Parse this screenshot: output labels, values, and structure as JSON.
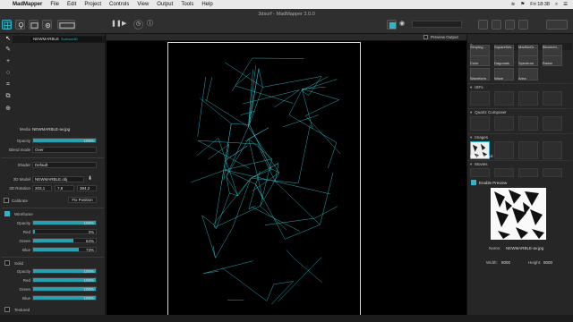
{
  "menubar": {
    "app_name": "MadMapper",
    "items": [
      "File",
      "Edit",
      "Project",
      "Controls",
      "View",
      "Output",
      "Tools",
      "Help"
    ],
    "clock": "Fri 18:38"
  },
  "window": {
    "title": "3dsurf - MadMapper 3.0.0"
  },
  "viewport": {
    "preview_output_label": "Preview Output"
  },
  "surface": {
    "name": "NEWMARBLE",
    "subtitle": "Surface3D"
  },
  "properties": {
    "media_label": "Media",
    "media_value": "NEWMARBLE-av.jpg",
    "opacity_label": "Opacity",
    "opacity_value": "100%",
    "opacity_level": 1.0,
    "blend_label": "Blend mode",
    "blend_value": "Over",
    "shader_label": "Shader",
    "shader_value": "Default",
    "model_label": "3D Model",
    "model_value": "NEWMARBLE.obj",
    "rotation_label": "3D Rotation",
    "rotation_x": "203,1",
    "rotation_y": "7,8",
    "rotation_z": "384,2",
    "calibrate_label": "Calibrate",
    "fix_position_label": "Fix Position"
  },
  "wireframe": {
    "label": "Wireframe",
    "opacity_label": "Opacity",
    "opacity_value": "100%",
    "opacity_level": 1.0,
    "red_label": "Red",
    "red_value": "3%",
    "red_level": 0.03,
    "green_label": "Green",
    "green_value": "64%",
    "green_level": 0.64,
    "blue_label": "Blue",
    "blue_value": "73%",
    "blue_level": 0.73
  },
  "solid": {
    "label": "Solid",
    "opacity_label": "Opacity",
    "opacity_value": "100%",
    "opacity_level": 1.0,
    "red_label": "Red",
    "red_value": "100%",
    "red_level": 1.0,
    "green_label": "Green",
    "green_value": "100%",
    "green_level": 1.0,
    "blue_label": "Blue",
    "blue_value": "100%",
    "blue_level": 1.0
  },
  "textured_label": "Textured",
  "library": {
    "generators": [
      "Simpleg...",
      "SquareWa...",
      "MadNoGr...",
      "Bloomen..."
    ],
    "generators_row2": [
      "Color",
      "Dagonals",
      "Spectrum",
      "Radar"
    ],
    "generators_row3": [
      "Waveform",
      "Wave",
      "Area"
    ],
    "section_sd": "ISFs",
    "section_qc": "Quartz Composer",
    "section_images": "Images",
    "image_item": "NEWMARBLE",
    "section_movies": "Movies"
  },
  "preview": {
    "enable_label": "Enable Preview",
    "name_label": "Name:",
    "name_value": "NEWMARBLE-av.jpg",
    "width_label": "Width:",
    "width_value": "8000",
    "height_label": "Height:",
    "height_value": "8000"
  },
  "colors": {
    "accent": "#2bb7c9",
    "wire": "#36c9d4"
  }
}
